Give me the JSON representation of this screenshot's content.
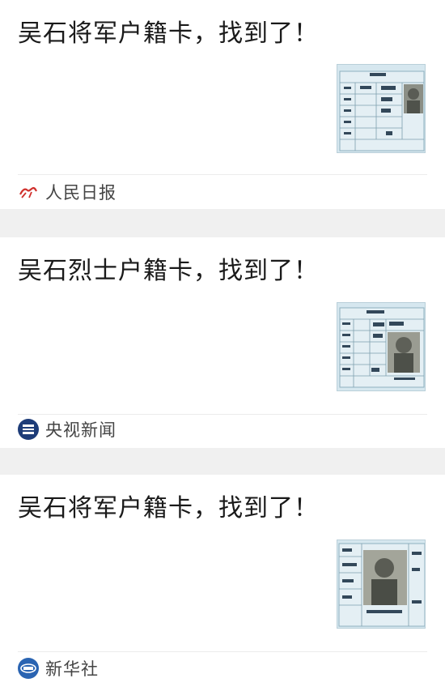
{
  "articles": [
    {
      "title": "吴石将军户籍卡，找到了！",
      "source": "人民日报",
      "logo_icon": "renmin-ribao-logo-icon"
    },
    {
      "title": "吴石烈士户籍卡，找到了！",
      "source": "央视新闻",
      "logo_icon": "cctv-news-logo-icon"
    },
    {
      "title": "吴石将军户籍卡，找到了！",
      "source": "新华社",
      "logo_icon": "xinhua-logo-icon"
    }
  ],
  "colors": {
    "background": "#f0f0f0",
    "card": "#ffffff",
    "title": "#1a1a1a",
    "source_text": "#444444",
    "renmin_red": "#d0312d",
    "cctv_blue": "#1d3c78",
    "xinhua_blue": "#2a64b2"
  }
}
